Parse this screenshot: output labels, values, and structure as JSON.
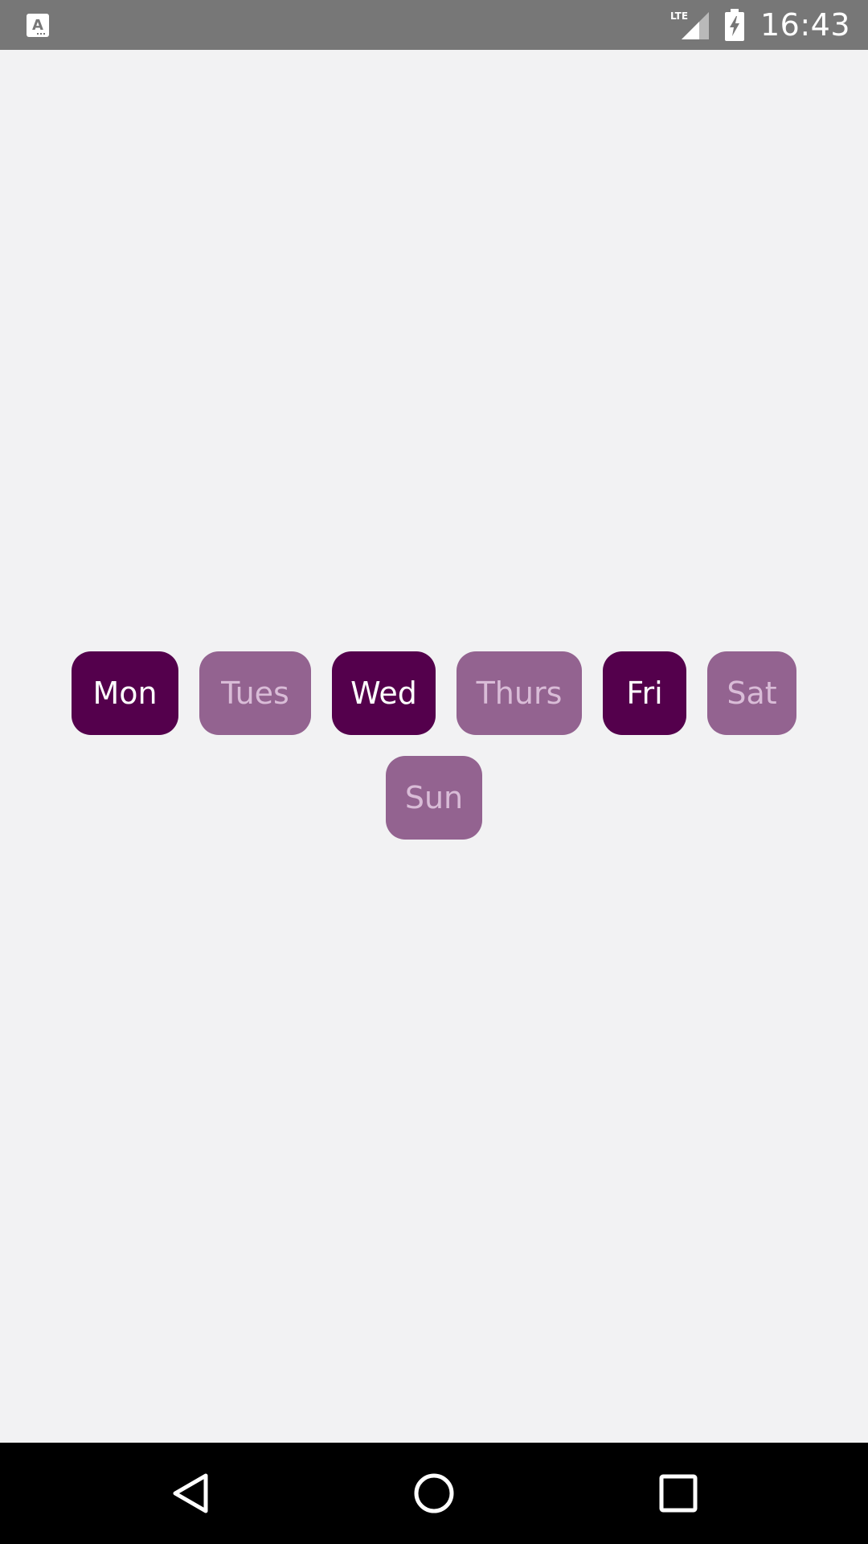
{
  "status_bar": {
    "time": "16:43",
    "icons": [
      "text-recognition-icon",
      "lte-signal-icon",
      "battery-charging-icon"
    ]
  },
  "days": [
    {
      "label": "Mon",
      "selected": true
    },
    {
      "label": "Tues",
      "selected": false
    },
    {
      "label": "Wed",
      "selected": true
    },
    {
      "label": "Thurs",
      "selected": false
    },
    {
      "label": "Fri",
      "selected": true
    },
    {
      "label": "Sat",
      "selected": false
    },
    {
      "label": "Sun",
      "selected": false
    }
  ],
  "colors": {
    "selected_bg": "#54004c",
    "selected_text": "#ffffff",
    "unselected_bg": "#936390",
    "unselected_text": "#d9bcd7",
    "background": "#f2f2f3",
    "status_bar": "#777777",
    "nav_bar": "#000000"
  },
  "nav_bar": {
    "icons": [
      "back-icon",
      "home-icon",
      "recents-icon"
    ]
  }
}
